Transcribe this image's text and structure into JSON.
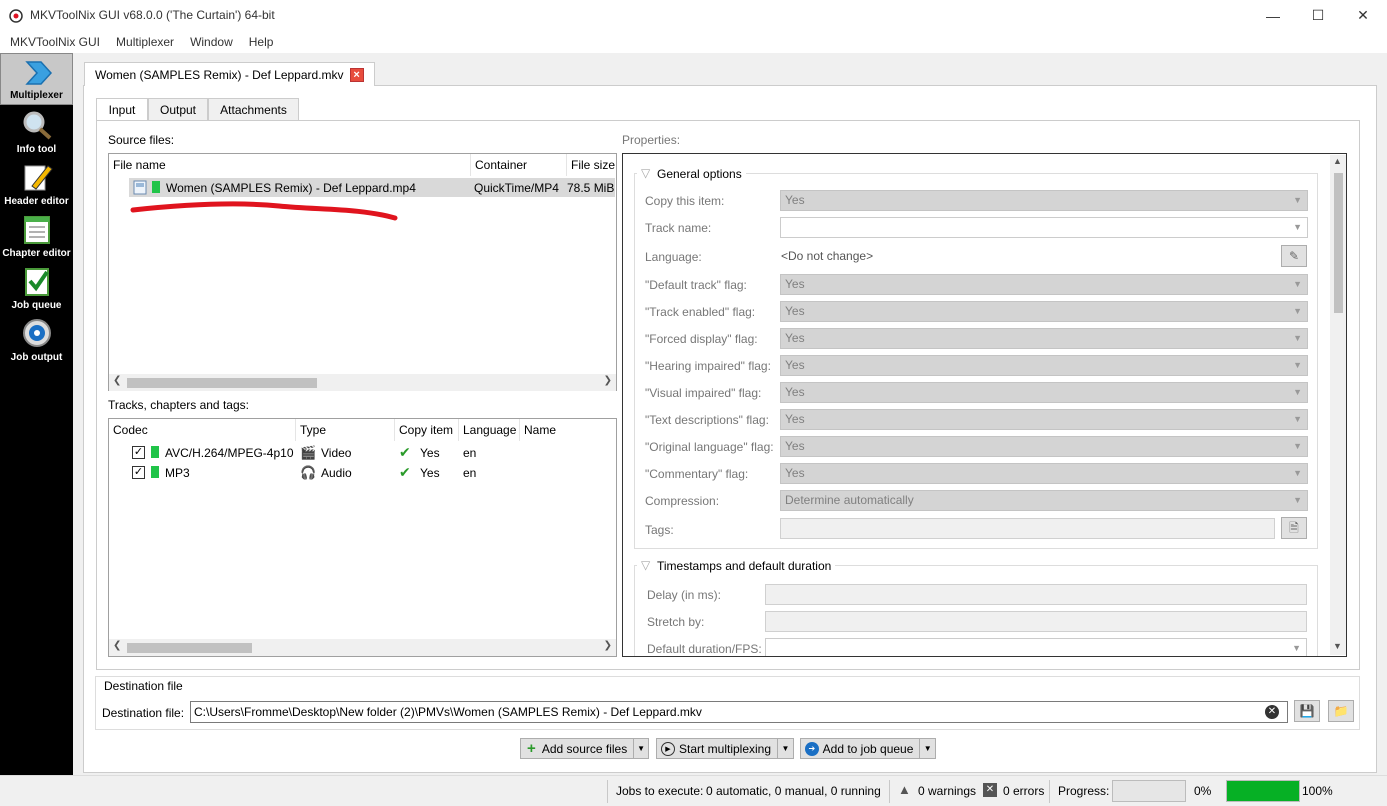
{
  "window": {
    "title": "MKVToolNix GUI v68.0.0 ('The Curtain') 64-bit",
    "minimize": "—",
    "maximize": "☐",
    "close": "✕"
  },
  "menu": [
    "MKVToolNix GUI",
    "Multiplexer",
    "Window",
    "Help"
  ],
  "sidebar": [
    {
      "label": "Multiplexer",
      "icon": "multiplexer-icon",
      "active": true
    },
    {
      "label": "Info tool",
      "icon": "magnifier-icon"
    },
    {
      "label": "Header editor",
      "icon": "pencil-icon"
    },
    {
      "label": "Chapter editor",
      "icon": "chapter-list-icon"
    },
    {
      "label": "Job queue",
      "icon": "clipboard-check-icon"
    },
    {
      "label": "Job output",
      "icon": "gear-icon"
    }
  ],
  "doc_tab": {
    "label": "Women (SAMPLES Remix) - Def Leppard.mkv",
    "close": "×"
  },
  "subtabs": [
    "Input",
    "Output",
    "Attachments"
  ],
  "source_files": {
    "label": "Source files:",
    "columns": [
      "File name",
      "Container",
      "File size"
    ],
    "rows": [
      {
        "name": "Women (SAMPLES Remix) - Def Leppard.mp4",
        "container": "QuickTime/MP4",
        "size": "78.5 MiB"
      }
    ]
  },
  "tracks": {
    "label": "Tracks, chapters and tags:",
    "columns": [
      "Codec",
      "Type",
      "Copy item",
      "Language",
      "Name"
    ],
    "rows": [
      {
        "codec": "AVC/H.264/MPEG-4p10",
        "type": "Video",
        "copy": "Yes",
        "language": "en",
        "type_icon": "film-icon"
      },
      {
        "codec": "MP3",
        "type": "Audio",
        "copy": "Yes",
        "language": "en",
        "type_icon": "headphones-icon"
      }
    ]
  },
  "properties": {
    "label": "Properties:",
    "general": {
      "title": "General options",
      "rows": [
        {
          "label": "Copy this item:",
          "value": "Yes"
        },
        {
          "label": "Track name:",
          "value": ""
        },
        {
          "label": "Language:",
          "value": "<Do not change>"
        },
        {
          "label": "\"Default track\" flag:",
          "value": "Yes"
        },
        {
          "label": "\"Track enabled\" flag:",
          "value": "Yes"
        },
        {
          "label": "\"Forced display\" flag:",
          "value": "Yes"
        },
        {
          "label": "\"Hearing impaired\" flag:",
          "value": "Yes"
        },
        {
          "label": "\"Visual impaired\" flag:",
          "value": "Yes"
        },
        {
          "label": "\"Text descriptions\" flag:",
          "value": "Yes"
        },
        {
          "label": "\"Original language\" flag:",
          "value": "Yes"
        },
        {
          "label": "\"Commentary\" flag:",
          "value": "Yes"
        },
        {
          "label": "Compression:",
          "value": "Determine automatically"
        },
        {
          "label": "Tags:",
          "value": ""
        }
      ]
    },
    "timestamps": {
      "title": "Timestamps and default duration",
      "rows": [
        {
          "label": "Delay (in ms):",
          "value": ""
        },
        {
          "label": "Stretch by:",
          "value": ""
        },
        {
          "label": "Default duration/FPS:",
          "value": ""
        }
      ]
    }
  },
  "destination": {
    "group_label": "Destination file",
    "label": "Destination file:",
    "value": "C:\\Users\\Fromme\\Desktop\\New folder (2)\\PMVs\\Women (SAMPLES Remix) - Def Leppard.mkv"
  },
  "actions": {
    "add_source": "Add source files",
    "start": "Start multiplexing",
    "add_queue": "Add to job queue"
  },
  "status": {
    "jobs_label": "Jobs to execute:",
    "jobs_value": "0 automatic, 0 manual, 0 running",
    "warnings": "0 warnings",
    "errors": "0 errors",
    "progress_label": "Progress:",
    "progress_pct": "0%",
    "total_pct": "100%",
    "progress_fraction": 0,
    "total_fraction": 1
  },
  "colors": {
    "accent_green": "#21c449",
    "progress_green": "#06b025",
    "annotation_red": "#e0141e"
  }
}
